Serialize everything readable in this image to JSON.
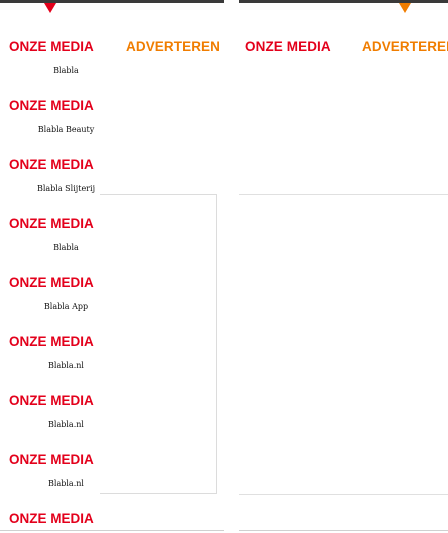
{
  "colors": {
    "media": "#e3001b",
    "advertise": "#f07d00",
    "topbar": "#3a3a3a"
  },
  "icons": {
    "left_marker": "triangle-down-icon",
    "right_marker": "triangle-down-icon"
  },
  "left": {
    "tabs": {
      "media": "ONZE MEDIA",
      "advertise": "ADVERTEREN"
    },
    "items": [
      {
        "title": "ONZE MEDIA",
        "label": "Blabla"
      },
      {
        "title": "ONZE MEDIA",
        "label": "Blabla Beauty"
      },
      {
        "title": "ONZE MEDIA",
        "label": "Blabla Slijterij"
      },
      {
        "title": "ONZE MEDIA",
        "label": "Blabla"
      },
      {
        "title": "ONZE MEDIA",
        "label": "Blabla App"
      },
      {
        "title": "ONZE MEDIA",
        "label": "Blabla.nl"
      },
      {
        "title": "ONZE MEDIA",
        "label": "Blabla.nl"
      },
      {
        "title": "ONZE MEDIA",
        "label": "Blabla.nl"
      },
      {
        "title": "ONZE MEDIA",
        "label": ""
      }
    ]
  },
  "right": {
    "tabs": {
      "media": "ONZE MEDIA",
      "advertise": "ADVERTEREN"
    }
  }
}
